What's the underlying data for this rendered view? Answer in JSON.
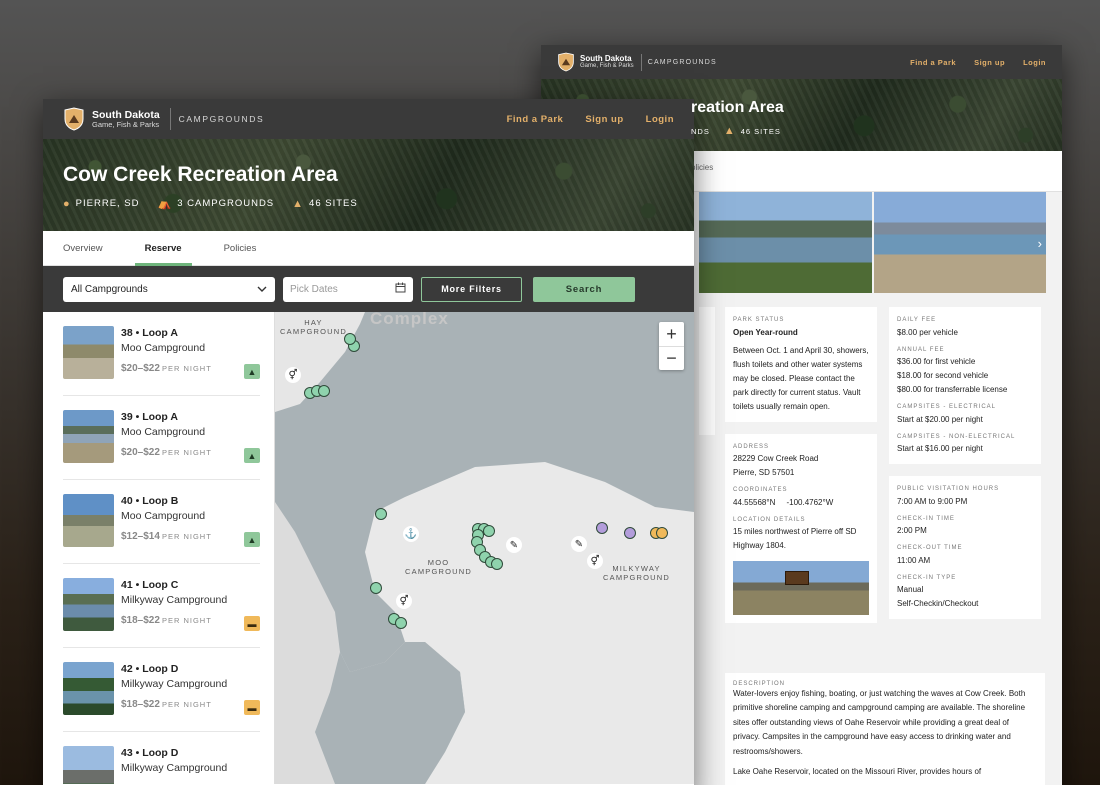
{
  "brand": {
    "name": "South Dakota",
    "sub": "Game, Fish & Parks",
    "section": "CAMPGROUNDS"
  },
  "nav": {
    "find": "Find a Park",
    "signup": "Sign up",
    "login": "Login"
  },
  "front": {
    "title": "Cow Creek Recreation Area",
    "meta": {
      "location": "PIERRE, SD",
      "campgrounds": "3 CAMPGROUNDS",
      "sites": "46 SITES"
    },
    "tabs": [
      "Overview",
      "Reserve",
      "Policies"
    ],
    "active_tab": "Reserve",
    "filters": {
      "campground_value": "All Campgrounds",
      "dates_placeholder": "Pick Dates",
      "more_filters": "More Filters",
      "search": "Search"
    },
    "sites": [
      {
        "title": "38 • Loop A",
        "campground": "Moo Campground",
        "price": "$20–$22",
        "unit": "PER NIGHT",
        "type": "tent"
      },
      {
        "title": "39 • Loop A",
        "campground": "Moo Campground",
        "price": "$20–$22",
        "unit": "PER NIGHT",
        "type": "tent"
      },
      {
        "title": "40 • Loop B",
        "campground": "Moo Campground",
        "price": "$12–$14",
        "unit": "PER NIGHT",
        "type": "tent"
      },
      {
        "title": "41 • Loop C",
        "campground": "Milkyway Campground",
        "price": "$18–$22",
        "unit": "PER NIGHT",
        "type": "rv"
      },
      {
        "title": "42 • Loop D",
        "campground": "Milkyway Campground",
        "price": "$18–$22",
        "unit": "PER NIGHT",
        "type": "rv"
      },
      {
        "title": "43 • Loop D",
        "campground": "Milkyway Campground",
        "price": "",
        "unit": "",
        "type": "cabin"
      }
    ],
    "map": {
      "labels": {
        "hay": "HAY\nCAMPGROUND",
        "moo": "MOO\nCAMPGROUND",
        "milkyway": "MILKYWAY\nCAMPGROUND",
        "region": "Complex"
      },
      "zoom_in": "+",
      "zoom_out": "−"
    }
  },
  "back": {
    "title_fragment": "reation Area",
    "meta": {
      "campgrounds": "NDS",
      "sites": "46 SITES"
    },
    "tab_fragment": "olicies",
    "park_status": {
      "label": "PARK STATUS",
      "value": "Open Year-round",
      "text": "Between Oct. 1 and April 30, showers, flush toilets and other water systems may be closed. Please contact the park directly for current status. Vault toilets usually remain open."
    },
    "fees": {
      "daily_label": "DAILY FEE",
      "daily_value": "$8.00 per vehicle",
      "annual_label": "ANNUAL FEE",
      "annual_values": [
        "$36.00 for first vehicle",
        "$18.00 for second vehicle",
        "$80.00 for transferrable license"
      ],
      "electrical_label": "CAMPSITES - ELECTRICAL",
      "electrical_value": "Start at $20.00 per night",
      "nonelectrical_label": "CAMPSITES - NON-ELECTRICAL",
      "nonelectrical_value": "Start at $16.00 per night"
    },
    "address": {
      "label": "ADDRESS",
      "line1": "28229 Cow Creek Road",
      "line2": "Pierre, SD 57501",
      "coords_label": "COORDINATES",
      "lat": "44.55568°N",
      "lon": "-100.4762°W",
      "location_label": "LOCATION DETAILS",
      "location_value": "15 miles northwest of Pierre off SD Highway 1804."
    },
    "hours": {
      "visit_label": "PUBLIC VISITATION HOURS",
      "visit_value": "7:00 AM to 9:00 PM",
      "checkin_label": "CHECK-IN TIME",
      "checkin_value": "2:00 PM",
      "checkout_label": "CHECK-OUT TIME",
      "checkout_value": "11:00 AM",
      "type_label": "CHECK-IN TYPE",
      "type_value1": "Manual",
      "type_value2": "Self-Checkin/Checkout"
    },
    "description": {
      "label": "DESCRIPTION",
      "p1": "Water-lovers enjoy fishing, boating, or just watching the waves at Cow Creek. Both primitive shoreline camping and campground camping are available. The shoreline sites offer outstanding views of Oahe Reservoir while providing a great deal of privacy. Campsites in the campground have easy access to drinking water and restrooms/showers.",
      "p2": "Lake Oahe Reservoir, located on the Missouri River, provides hours of"
    }
  },
  "colors": {
    "accent_green": "#8fc79a",
    "accent_gold": "#e3b06a",
    "nav_bg": "#3a3a3a",
    "tent": "#8fc79a",
    "rv": "#f0b95a",
    "cabin": "#b39ddb"
  },
  "icons": [
    "shield-logo-icon",
    "location-pin-icon",
    "tent-icon",
    "calendar-icon",
    "chevron-down-icon",
    "restroom-icon",
    "boat-ramp-icon",
    "fishing-icon",
    "sign-icon",
    "chevron-right-icon"
  ]
}
